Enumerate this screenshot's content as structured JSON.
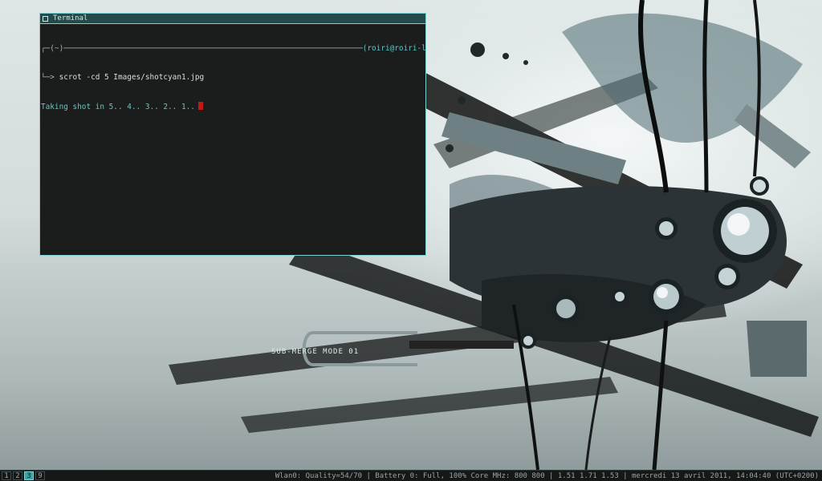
{
  "terminal": {
    "title": "Terminal",
    "prompt_line_left": "┌─(~)",
    "prompt_line_user": "(roiri@roiri-laptop)",
    "prompt_arrow": "└─> ",
    "command": "scrot -cd 5 Images/shotcyan1.jpg",
    "output": "Taking shot in 5.. 4.. 3.. 2.. 1.."
  },
  "wallpaper": {
    "caption": "SUB-MERGE MODE 01"
  },
  "statusbar": {
    "workspaces": [
      "1",
      "2",
      "3",
      "9"
    ],
    "active_workspace": "3",
    "info": "Wlan0: Quality=54/70 | Battery 0: Full, 100% Core MHz: 800 800 | 1.51 1.71 1.53 | mercredi 13 avril 2011, 14:04:40 (UTC+0200)"
  },
  "colors": {
    "accent": "#7fd0d0",
    "terminal_bg": "#1b1c1c",
    "cursor": "#c21818"
  }
}
